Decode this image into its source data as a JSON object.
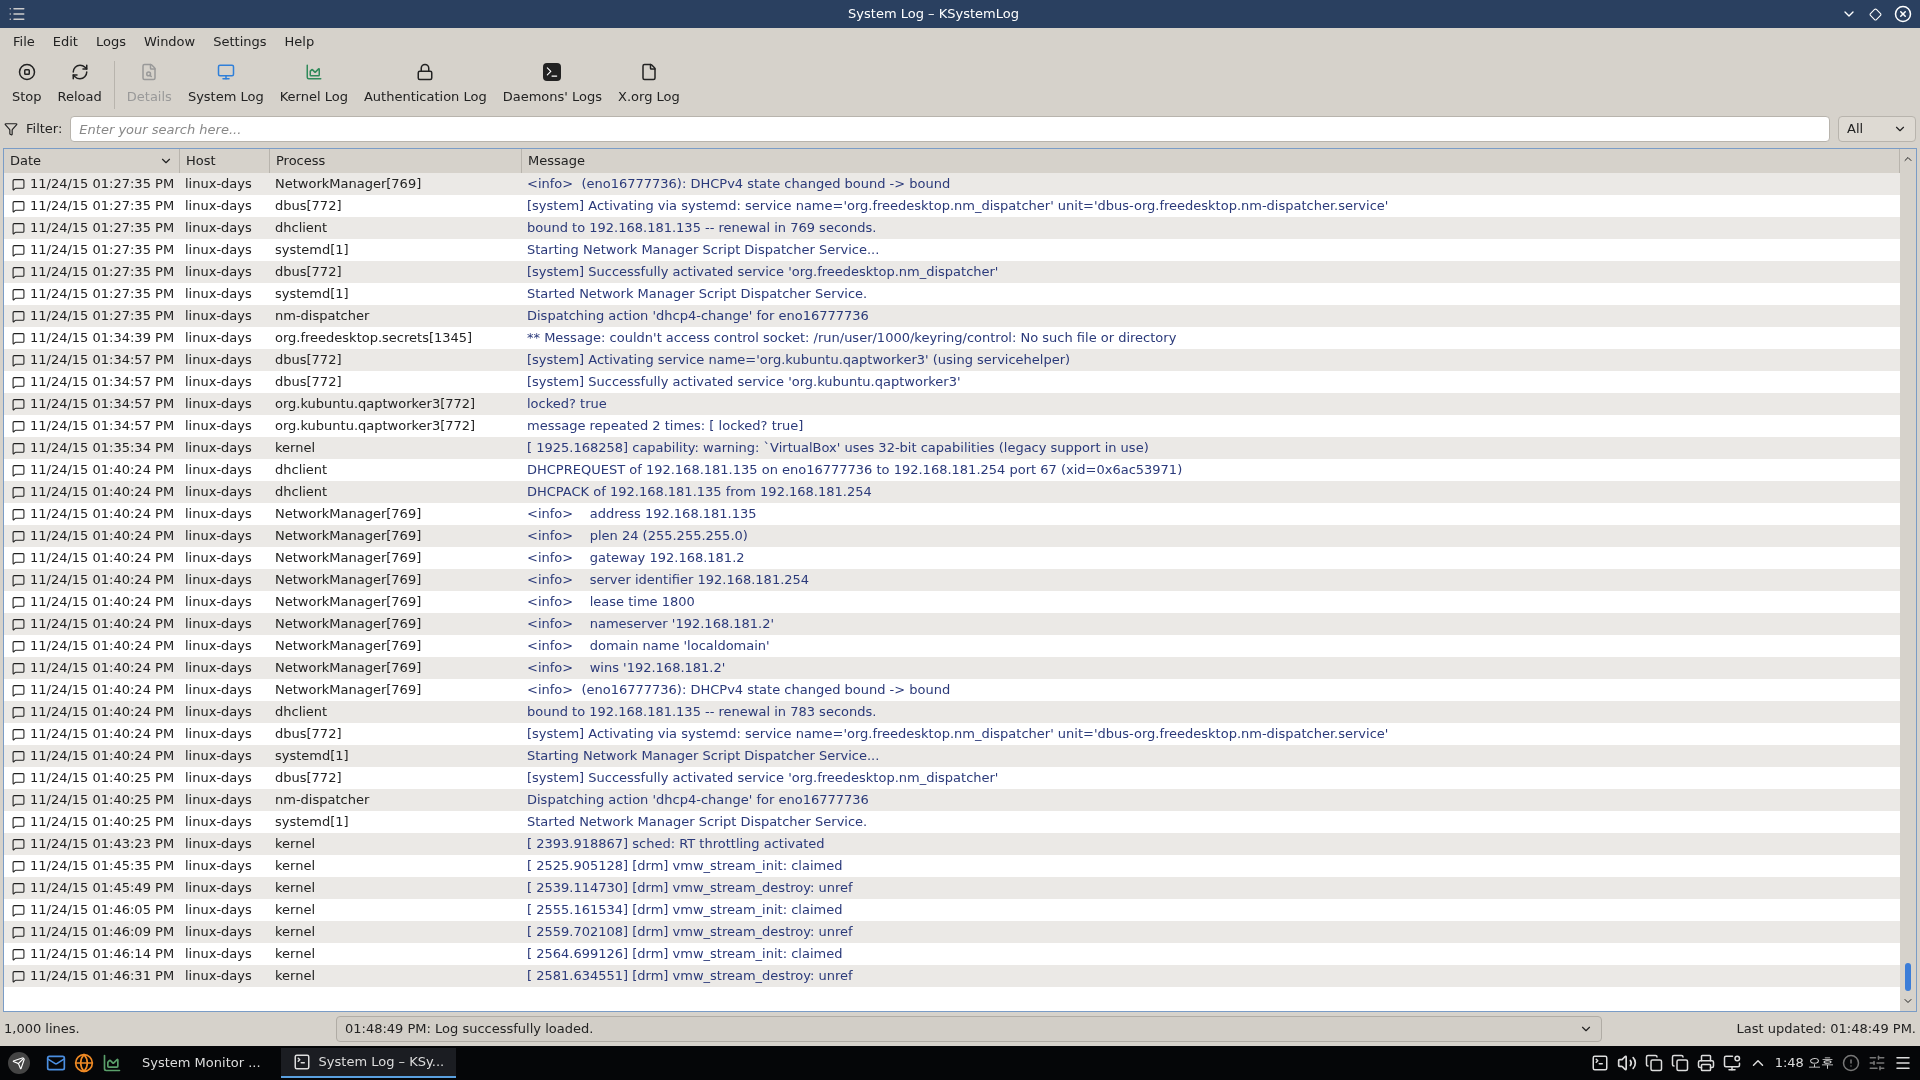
{
  "window": {
    "title": "System Log – KSystemLog"
  },
  "menu": [
    "File",
    "Edit",
    "Logs",
    "Window",
    "Settings",
    "Help"
  ],
  "toolbar": [
    {
      "kind": "stop",
      "label": "Stop",
      "disabled": false
    },
    {
      "kind": "reload",
      "label": "Reload",
      "disabled": false
    },
    {
      "kind": "details",
      "label": "Details",
      "disabled": true
    },
    {
      "kind": "system",
      "label": "System Log",
      "disabled": false
    },
    {
      "kind": "kernel",
      "label": "Kernel Log",
      "disabled": false
    },
    {
      "kind": "auth",
      "label": "Authentication Log",
      "disabled": false
    },
    {
      "kind": "daemons",
      "label": "Daemons' Logs",
      "disabled": false
    },
    {
      "kind": "xorg",
      "label": "X.org Log",
      "disabled": false
    }
  ],
  "filter": {
    "label": "Filter:",
    "placeholder": "Enter your search here...",
    "scope": "All"
  },
  "table": {
    "columns": [
      "Date",
      "Host",
      "Process",
      "Message"
    ],
    "rows": [
      {
        "date": "11/24/15 01:27:35 PM",
        "host": "linux-days",
        "process": "NetworkManager[769]",
        "message": "<info>  (eno16777736): DHCPv4 state changed bound -> bound"
      },
      {
        "date": "11/24/15 01:27:35 PM",
        "host": "linux-days",
        "process": "dbus[772]",
        "message": "[system] Activating via systemd: service name='org.freedesktop.nm_dispatcher' unit='dbus-org.freedesktop.nm-dispatcher.service'"
      },
      {
        "date": "11/24/15 01:27:35 PM",
        "host": "linux-days",
        "process": "dhclient",
        "message": "bound to 192.168.181.135 -- renewal in 769 seconds."
      },
      {
        "date": "11/24/15 01:27:35 PM",
        "host": "linux-days",
        "process": "systemd[1]",
        "message": "Starting Network Manager Script Dispatcher Service..."
      },
      {
        "date": "11/24/15 01:27:35 PM",
        "host": "linux-days",
        "process": "dbus[772]",
        "message": "[system] Successfully activated service 'org.freedesktop.nm_dispatcher'"
      },
      {
        "date": "11/24/15 01:27:35 PM",
        "host": "linux-days",
        "process": "systemd[1]",
        "message": "Started Network Manager Script Dispatcher Service."
      },
      {
        "date": "11/24/15 01:27:35 PM",
        "host": "linux-days",
        "process": "nm-dispatcher",
        "message": "Dispatching action 'dhcp4-change' for eno16777736"
      },
      {
        "date": "11/24/15 01:34:39 PM",
        "host": "linux-days",
        "process": "org.freedesktop.secrets[1345]",
        "message": "** Message: couldn't access control socket: /run/user/1000/keyring/control: No such file or directory"
      },
      {
        "date": "11/24/15 01:34:57 PM",
        "host": "linux-days",
        "process": "dbus[772]",
        "message": "[system] Activating service name='org.kubuntu.qaptworker3' (using servicehelper)"
      },
      {
        "date": "11/24/15 01:34:57 PM",
        "host": "linux-days",
        "process": "dbus[772]",
        "message": "[system] Successfully activated service 'org.kubuntu.qaptworker3'"
      },
      {
        "date": "11/24/15 01:34:57 PM",
        "host": "linux-days",
        "process": "org.kubuntu.qaptworker3[772]",
        "message": "locked? true"
      },
      {
        "date": "11/24/15 01:34:57 PM",
        "host": "linux-days",
        "process": "org.kubuntu.qaptworker3[772]",
        "message": "message repeated 2 times: [ locked? true]"
      },
      {
        "date": "11/24/15 01:35:34 PM",
        "host": "linux-days",
        "process": "kernel",
        "message": "[ 1925.168258] capability: warning: `VirtualBox' uses 32-bit capabilities (legacy support in use)"
      },
      {
        "date": "11/24/15 01:40:24 PM",
        "host": "linux-days",
        "process": "dhclient",
        "message": "DHCPREQUEST of 192.168.181.135 on eno16777736 to 192.168.181.254 port 67 (xid=0x6ac53971)"
      },
      {
        "date": "11/24/15 01:40:24 PM",
        "host": "linux-days",
        "process": "dhclient",
        "message": "DHCPACK of 192.168.181.135 from 192.168.181.254"
      },
      {
        "date": "11/24/15 01:40:24 PM",
        "host": "linux-days",
        "process": "NetworkManager[769]",
        "message": "<info>    address 192.168.181.135"
      },
      {
        "date": "11/24/15 01:40:24 PM",
        "host": "linux-days",
        "process": "NetworkManager[769]",
        "message": "<info>    plen 24 (255.255.255.0)"
      },
      {
        "date": "11/24/15 01:40:24 PM",
        "host": "linux-days",
        "process": "NetworkManager[769]",
        "message": "<info>    gateway 192.168.181.2"
      },
      {
        "date": "11/24/15 01:40:24 PM",
        "host": "linux-days",
        "process": "NetworkManager[769]",
        "message": "<info>    server identifier 192.168.181.254"
      },
      {
        "date": "11/24/15 01:40:24 PM",
        "host": "linux-days",
        "process": "NetworkManager[769]",
        "message": "<info>    lease time 1800"
      },
      {
        "date": "11/24/15 01:40:24 PM",
        "host": "linux-days",
        "process": "NetworkManager[769]",
        "message": "<info>    nameserver '192.168.181.2'"
      },
      {
        "date": "11/24/15 01:40:24 PM",
        "host": "linux-days",
        "process": "NetworkManager[769]",
        "message": "<info>    domain name 'localdomain'"
      },
      {
        "date": "11/24/15 01:40:24 PM",
        "host": "linux-days",
        "process": "NetworkManager[769]",
        "message": "<info>    wins '192.168.181.2'"
      },
      {
        "date": "11/24/15 01:40:24 PM",
        "host": "linux-days",
        "process": "NetworkManager[769]",
        "message": "<info>  (eno16777736): DHCPv4 state changed bound -> bound"
      },
      {
        "date": "11/24/15 01:40:24 PM",
        "host": "linux-days",
        "process": "dhclient",
        "message": "bound to 192.168.181.135 -- renewal in 783 seconds."
      },
      {
        "date": "11/24/15 01:40:24 PM",
        "host": "linux-days",
        "process": "dbus[772]",
        "message": "[system] Activating via systemd: service name='org.freedesktop.nm_dispatcher' unit='dbus-org.freedesktop.nm-dispatcher.service'"
      },
      {
        "date": "11/24/15 01:40:24 PM",
        "host": "linux-days",
        "process": "systemd[1]",
        "message": "Starting Network Manager Script Dispatcher Service..."
      },
      {
        "date": "11/24/15 01:40:25 PM",
        "host": "linux-days",
        "process": "dbus[772]",
        "message": "[system] Successfully activated service 'org.freedesktop.nm_dispatcher'"
      },
      {
        "date": "11/24/15 01:40:25 PM",
        "host": "linux-days",
        "process": "nm-dispatcher",
        "message": "Dispatching action 'dhcp4-change' for eno16777736"
      },
      {
        "date": "11/24/15 01:40:25 PM",
        "host": "linux-days",
        "process": "systemd[1]",
        "message": "Started Network Manager Script Dispatcher Service."
      },
      {
        "date": "11/24/15 01:43:23 PM",
        "host": "linux-days",
        "process": "kernel",
        "message": "[ 2393.918867] sched: RT throttling activated"
      },
      {
        "date": "11/24/15 01:45:35 PM",
        "host": "linux-days",
        "process": "kernel",
        "message": "[ 2525.905128] [drm] vmw_stream_init: claimed"
      },
      {
        "date": "11/24/15 01:45:49 PM",
        "host": "linux-days",
        "process": "kernel",
        "message": "[ 2539.114730] [drm] vmw_stream_destroy: unref"
      },
      {
        "date": "11/24/15 01:46:05 PM",
        "host": "linux-days",
        "process": "kernel",
        "message": "[ 2555.161534] [drm] vmw_stream_init: claimed"
      },
      {
        "date": "11/24/15 01:46:09 PM",
        "host": "linux-days",
        "process": "kernel",
        "message": "[ 2559.702108] [drm] vmw_stream_destroy: unref"
      },
      {
        "date": "11/24/15 01:46:14 PM",
        "host": "linux-days",
        "process": "kernel",
        "message": "[ 2564.699126] [drm] vmw_stream_init: claimed"
      },
      {
        "date": "11/24/15 01:46:31 PM",
        "host": "linux-days",
        "process": "kernel",
        "message": "[ 2581.634551] [drm] vmw_stream_destroy: unref"
      }
    ]
  },
  "status_bar": {
    "lines": "1,000 lines.",
    "message": "01:48:49 PM: Log successfully loaded.",
    "updated": "Last updated: 01:48:49 PM."
  },
  "taskbar": {
    "tasks": [
      {
        "label": "System Monitor ...",
        "selected": false
      },
      {
        "label": "System Log – KSy...",
        "selected": true
      }
    ],
    "clock": "1:48 오후"
  }
}
